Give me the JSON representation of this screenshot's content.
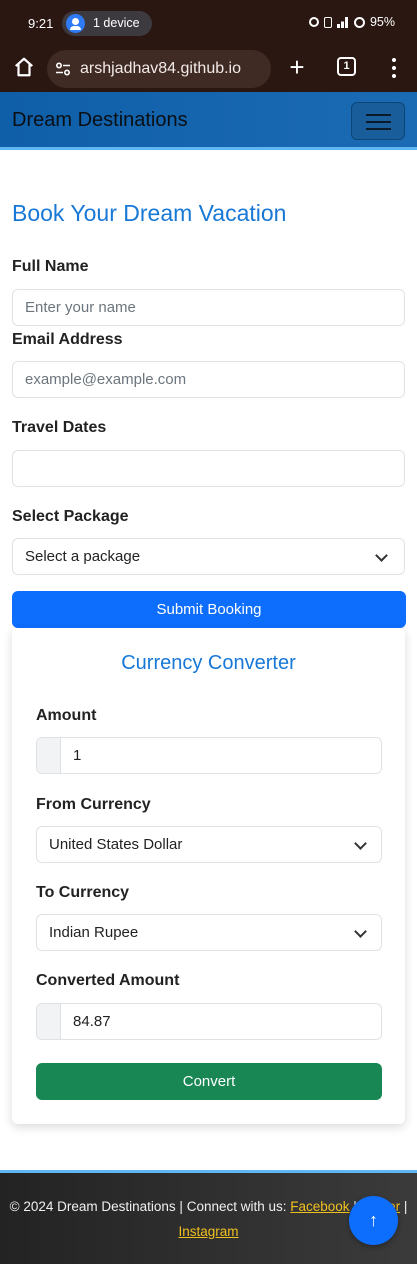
{
  "status_bar": {
    "time": "9:21",
    "device_pill": "1 device",
    "battery": "95%"
  },
  "browser": {
    "url": "arshjadhav84.github.io",
    "tab_count": "1",
    "new_tab_symbol": "+"
  },
  "navbar": {
    "brand": "Dream Destinations"
  },
  "booking_form": {
    "title": "Book Your Dream Vacation",
    "full_name_label": "Full Name",
    "full_name_placeholder": "Enter your name",
    "email_label": "Email Address",
    "email_placeholder": "example@example.com",
    "dates_label": "Travel Dates",
    "dates_value": "",
    "package_label": "Select Package",
    "package_selected": "Select a package",
    "submit_label": "Submit Booking"
  },
  "currency_converter": {
    "title": "Currency Converter",
    "amount_label": "Amount",
    "amount_value": "1",
    "from_label": "From Currency",
    "from_selected": "United States Dollar",
    "to_label": "To Currency",
    "to_selected": "Indian Rupee",
    "converted_label": "Converted Amount",
    "converted_value": "84.87",
    "convert_label": "Convert"
  },
  "footer": {
    "copyright": "© 2024 Dream Destinations | Connect with us: ",
    "facebook": "Facebook",
    "separator1": " | ",
    "twitter": "Twitter",
    "separator2": " |",
    "instagram": "Instagram"
  },
  "scroll_top": {
    "symbol": "↑"
  },
  "colors": {
    "status_bar_bg": "#2b1712",
    "navbar_bg": "#1565ae",
    "heading_blue": "#1778d6",
    "primary_button": "#0d6efd",
    "convert_button": "#198754",
    "footer_link": "#f0c020"
  }
}
